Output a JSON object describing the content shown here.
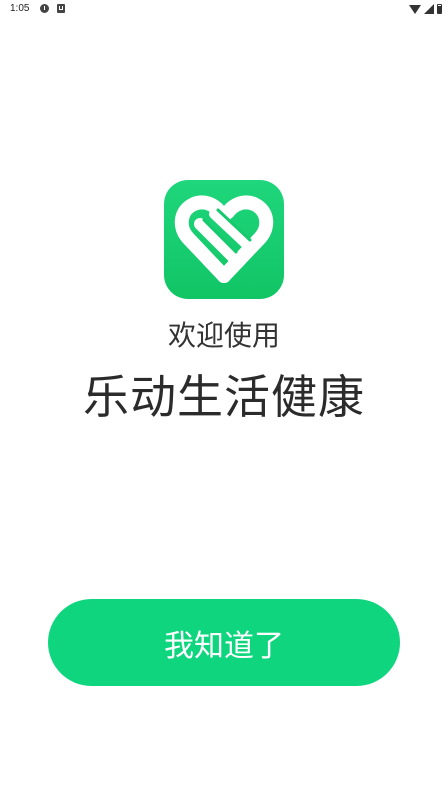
{
  "status_bar": {
    "time": "1:05",
    "icons": [
      "alert-notification-icon",
      "a-notification-icon",
      "wifi-icon",
      "signal-icon",
      "battery-icon"
    ]
  },
  "logo": {
    "icon": "heart-ribbon-logo-icon",
    "gradient_top": "#1fd67c",
    "gradient_bottom": "#11c565"
  },
  "welcome": {
    "subtitle": "欢迎使用",
    "title": "乐动生活健康"
  },
  "confirm_button": {
    "label": "我知道了",
    "color": "#0fd67e"
  }
}
